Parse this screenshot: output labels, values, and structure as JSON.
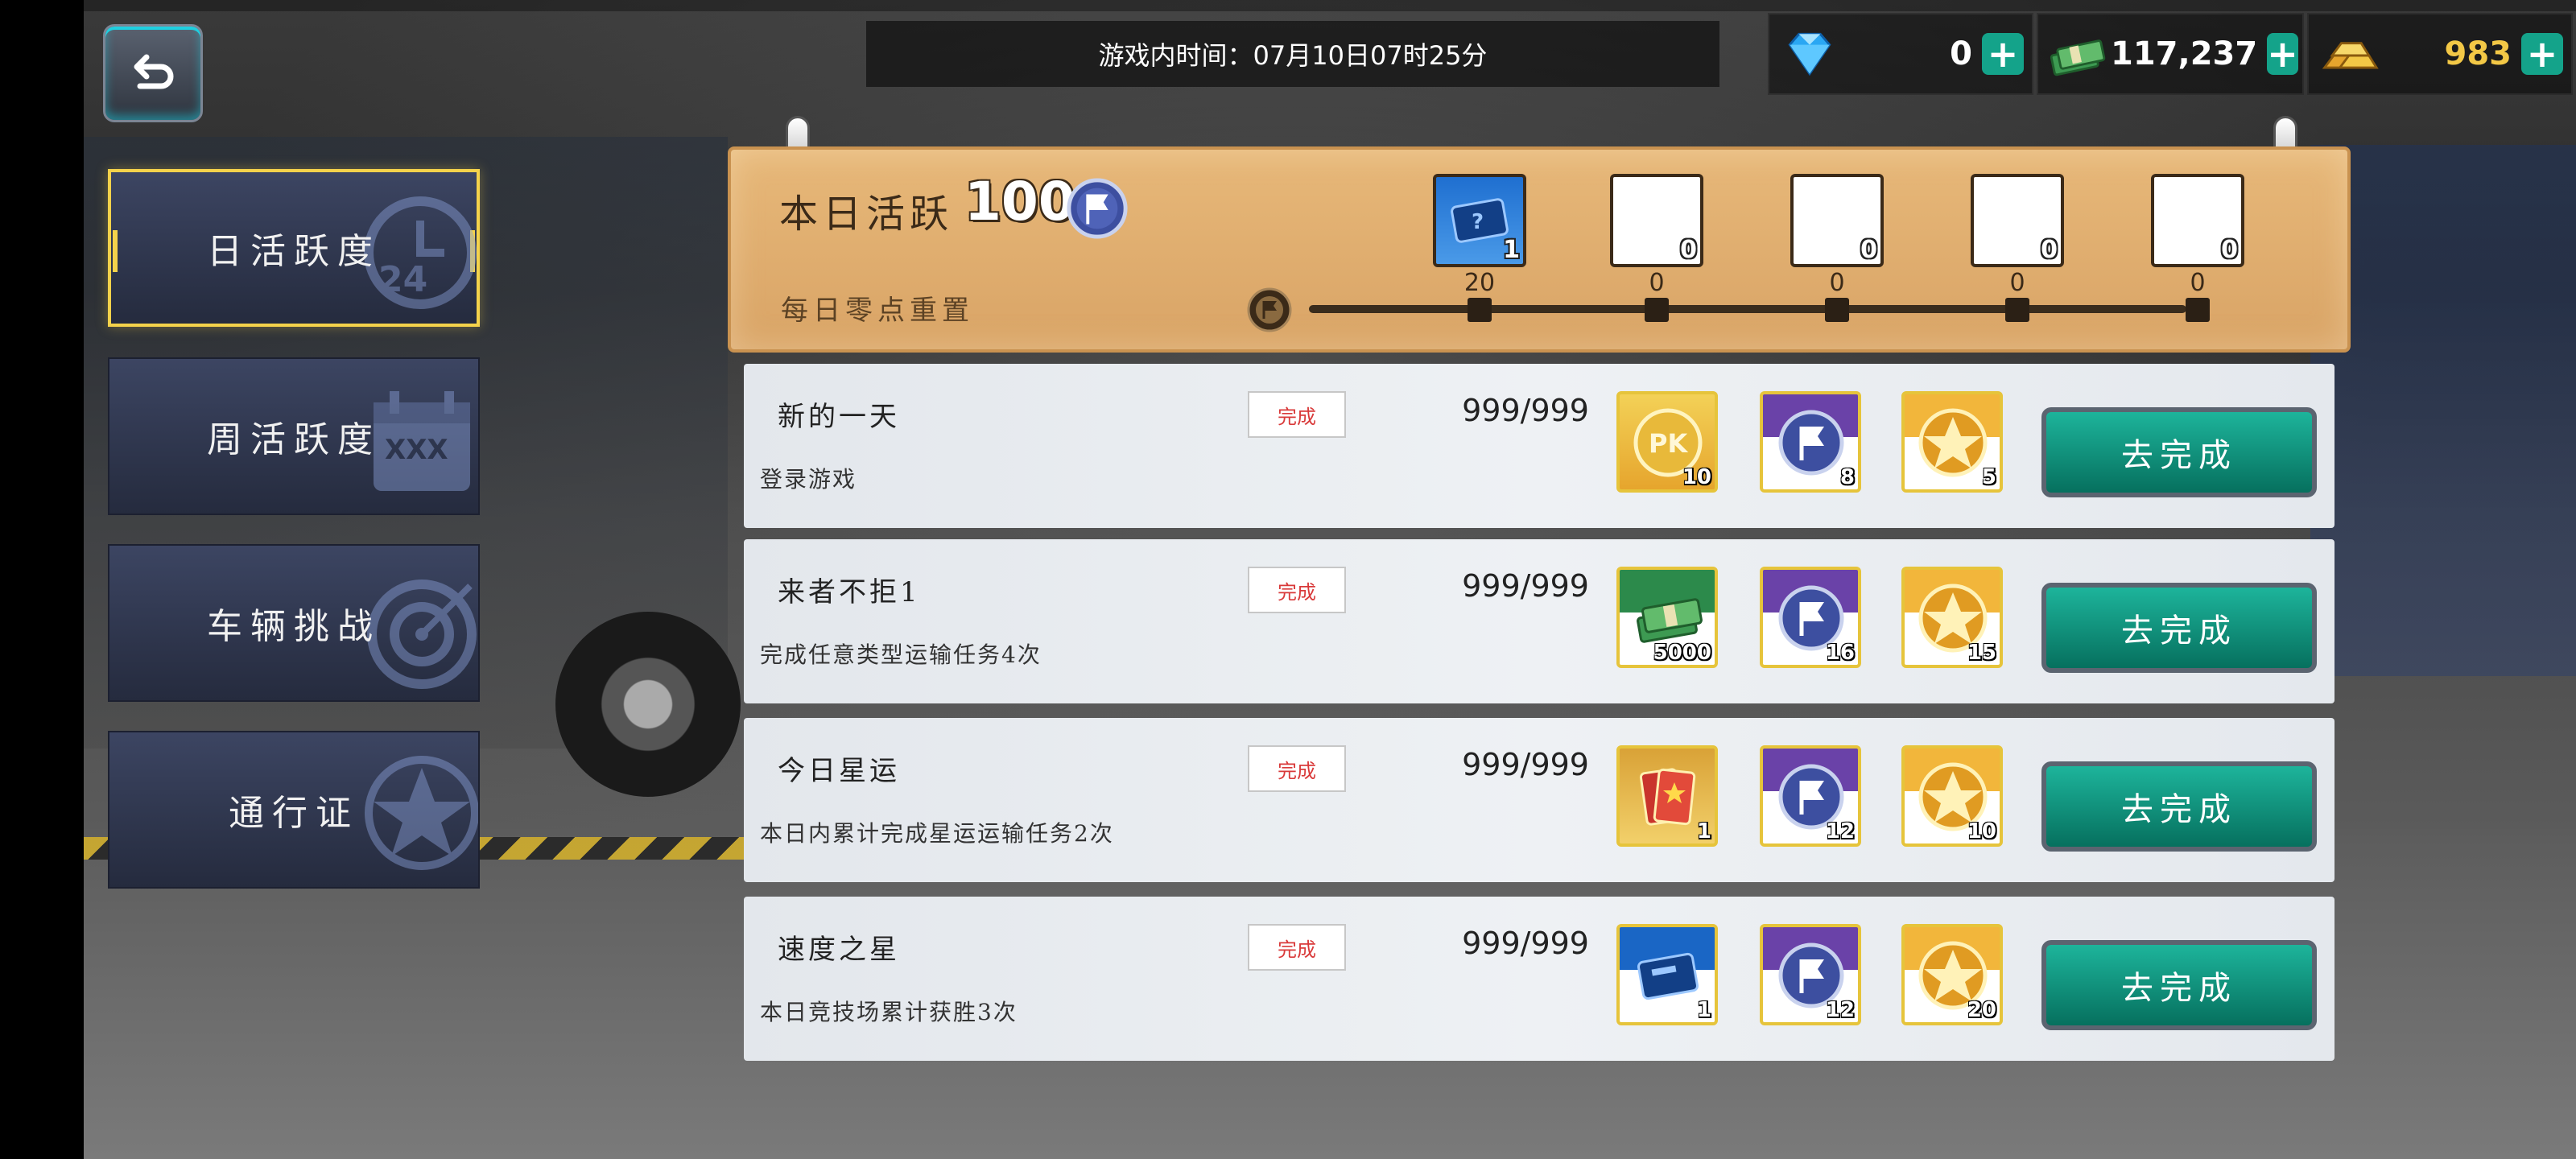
{
  "header": {
    "back_icon": "return-arrow-icon",
    "game_time": "游戏内时间：07月10日07时25分"
  },
  "currencies": [
    {
      "name": "diamond",
      "icon": "diamond-icon",
      "value": "0"
    },
    {
      "name": "cash",
      "icon": "cash-stack-icon",
      "value": "117,237"
    },
    {
      "name": "gold",
      "icon": "gold-bars-icon",
      "value": "983"
    }
  ],
  "tabs": [
    {
      "label": "日活跃度",
      "icon": "clock-24-icon",
      "active": true
    },
    {
      "label": "周活跃度",
      "icon": "calendar-icon",
      "active": false
    },
    {
      "label": "车辆挑战",
      "icon": "target-icon",
      "active": false
    },
    {
      "label": "通行证",
      "icon": "star-emblem-icon",
      "active": false
    }
  ],
  "activity": {
    "title": "本日活跃",
    "value": "100",
    "reset_text": "每日零点重置",
    "progress": 0.0,
    "milestones": [
      {
        "required": "20",
        "count": "1",
        "has_item": true
      },
      {
        "required": "0",
        "count": "0",
        "has_item": false
      },
      {
        "required": "0",
        "count": "0",
        "has_item": false
      },
      {
        "required": "0",
        "count": "0",
        "has_item": false
      },
      {
        "required": "0",
        "count": "0",
        "has_item": false
      }
    ]
  },
  "tasks": [
    {
      "name": "新的一天",
      "desc": "登录游戏",
      "badge": "完成",
      "progress": "999/999",
      "button": "去完成",
      "rewards": [
        {
          "icon": "pk-coin-icon",
          "count": "10"
        },
        {
          "icon": "flag-token-icon",
          "count": "8"
        },
        {
          "icon": "star-medal-icon",
          "count": "5"
        }
      ]
    },
    {
      "name": "来者不拒1",
      "desc": "完成任意类型运输任务4次",
      "badge": "完成",
      "progress": "999/999",
      "button": "去完成",
      "rewards": [
        {
          "icon": "cash-stack-icon",
          "count": "5000"
        },
        {
          "icon": "flag-token-icon",
          "count": "16"
        },
        {
          "icon": "star-medal-icon",
          "count": "15"
        }
      ]
    },
    {
      "name": "今日星运",
      "desc": "本日内累计完成星运运输任务2次",
      "badge": "完成",
      "progress": "999/999",
      "button": "去完成",
      "rewards": [
        {
          "icon": "ticket-icon",
          "count": "1"
        },
        {
          "icon": "flag-token-icon",
          "count": "12"
        },
        {
          "icon": "star-medal-icon",
          "count": "10"
        }
      ]
    },
    {
      "name": "速度之星",
      "desc": "本日竞技场累计获胜3次",
      "badge": "完成",
      "progress": "999/999",
      "button": "去完成",
      "rewards": [
        {
          "icon": "blue-card-icon",
          "count": "1"
        },
        {
          "icon": "flag-token-icon",
          "count": "12"
        },
        {
          "icon": "star-medal-icon",
          "count": "20"
        }
      ]
    }
  ],
  "colors": {
    "accent_gold": "#f4d24b",
    "button_teal": "#14a38a",
    "badge_red": "#d93a3a",
    "panel_tan": "#e1ae70"
  }
}
